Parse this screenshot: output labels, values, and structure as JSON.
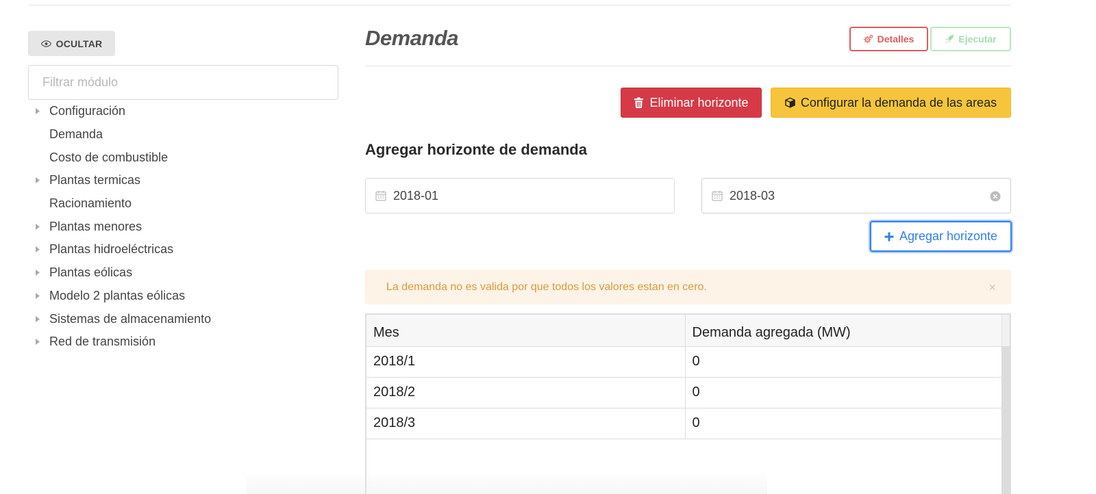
{
  "sidebar": {
    "hide_button": {
      "label": "OCULTAR",
      "icon": "eye-icon"
    },
    "filter": {
      "placeholder": "Filtrar módulo",
      "value": ""
    },
    "modules": [
      {
        "label": "Configuración",
        "expandable": true
      },
      {
        "label": "Demanda",
        "expandable": false
      },
      {
        "label": "Costo de combustible",
        "expandable": false
      },
      {
        "label": "Plantas termicas",
        "expandable": true
      },
      {
        "label": "Racionamiento",
        "expandable": false
      },
      {
        "label": "Plantas menores",
        "expandable": true
      },
      {
        "label": "Plantas hidroeléctricas",
        "expandable": true
      },
      {
        "label": "Plantas eólicas",
        "expandable": true
      },
      {
        "label": "Modelo 2 plantas eólicas",
        "expandable": true
      },
      {
        "label": "Sistemas de almacenamiento",
        "expandable": true
      },
      {
        "label": "Red de transmisión",
        "expandable": true
      }
    ]
  },
  "header": {
    "title": "Demanda",
    "details_button": {
      "label": "Detalles",
      "icon": "gears-icon",
      "color": "#e05a5a"
    },
    "run_button": {
      "label": "Ejecutar",
      "icon": "rocket-icon",
      "color": "#a6dbaf",
      "disabled": true
    }
  },
  "actions": {
    "delete_horizon": {
      "label": "Eliminar horizonte",
      "icon": "trash-icon",
      "color": "#d63a47"
    },
    "configure_areas": {
      "label": "Configurar la demanda de las areas",
      "icon": "cube-icon",
      "color": "#f7c53b"
    }
  },
  "horizon_form": {
    "title": "Agregar horizonte de demanda",
    "from_date": {
      "value": "2018-01",
      "icon": "calendar-icon"
    },
    "to_date": {
      "value": "2018-03",
      "icon": "calendar-icon",
      "clear_icon": "clear-circle-icon"
    },
    "add_button": {
      "label": "Agregar horizonte",
      "icon": "plus-icon",
      "color": "#2f80ed"
    }
  },
  "alert": {
    "message": "La demanda no es valida por que todos los valores estan en cero.",
    "close_symbol": "×",
    "color": "#d99a3c"
  },
  "table": {
    "columns": [
      "Mes",
      "Demanda agregada (MW)"
    ],
    "rows": [
      [
        "2018/1",
        "0"
      ],
      [
        "2018/2",
        "0"
      ],
      [
        "2018/3",
        "0"
      ]
    ]
  }
}
